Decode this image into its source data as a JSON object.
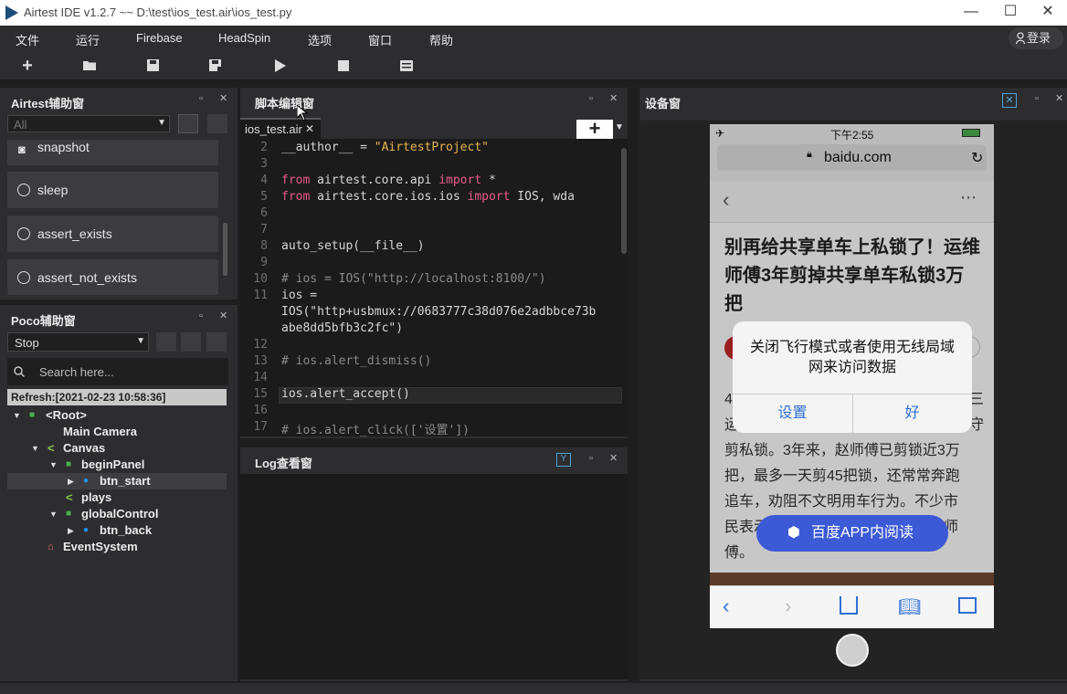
{
  "window": {
    "title": "Airtest IDE v1.2.7 ~~ D:\\test\\ios_test.air\\ios_test.py"
  },
  "menu": [
    "文件",
    "运行",
    "Firebase",
    "HeadSpin",
    "选项",
    "窗口",
    "帮助"
  ],
  "login_label": "登录",
  "airtest_panel": {
    "title": "Airtest辅助窗",
    "filter": "All",
    "commands": [
      "snapshot",
      "sleep",
      "assert_exists",
      "assert_not_exists"
    ]
  },
  "poco_panel": {
    "title": "Poco辅助窗",
    "mode": "Stop",
    "search_placeholder": "Search here...",
    "refresh": "Refresh:[2021-02-23 10:58:36]",
    "tree": [
      {
        "label": "<Root>",
        "depth": 0,
        "expanded": true
      },
      {
        "label": "Main Camera",
        "depth": 1
      },
      {
        "label": "Canvas",
        "depth": 1,
        "expanded": true
      },
      {
        "label": "beginPanel",
        "depth": 2,
        "expanded": true
      },
      {
        "label": "btn_start",
        "depth": 3,
        "selected": true,
        "collapsed": true
      },
      {
        "label": "plays",
        "depth": 3
      },
      {
        "label": "globalControl",
        "depth": 2,
        "expanded": true
      },
      {
        "label": "btn_back",
        "depth": 3,
        "collapsed": true
      },
      {
        "label": "EventSystem",
        "depth": 1
      }
    ]
  },
  "editor": {
    "title": "脚本编辑窗",
    "tab": "ios_test.air",
    "lines": [
      {
        "n": "2",
        "t": "__author__ = \"AirtestProject\""
      },
      {
        "n": "3",
        "t": ""
      },
      {
        "n": "4",
        "t": "from airtest.core.api import *"
      },
      {
        "n": "5",
        "t": "from airtest.core.ios.ios import IOS, wda"
      },
      {
        "n": "6",
        "t": ""
      },
      {
        "n": "7",
        "t": ""
      },
      {
        "n": "8",
        "t": "auto_setup(__file__)"
      },
      {
        "n": "9",
        "t": ""
      },
      {
        "n": "10",
        "t": "# ios = IOS(\"http://localhost:8100/\")"
      },
      {
        "n": "11",
        "t": "ios ="
      },
      {
        "n": "",
        "t": "IOS(\"http+usbmux://0683777c38d076e2adbbce73b"
      },
      {
        "n": "",
        "t": "abe8dd5bfb3c2fc\")"
      },
      {
        "n": "12",
        "t": ""
      },
      {
        "n": "13",
        "t": "# ios.alert_dismiss()"
      },
      {
        "n": "14",
        "t": ""
      },
      {
        "n": "15",
        "t": "ios.alert_accept()"
      },
      {
        "n": "16",
        "t": ""
      },
      {
        "n": "17",
        "t": "# ios.alert_click(['设置'])"
      }
    ]
  },
  "log_panel": {
    "title": "Log查看窗"
  },
  "device_panel": {
    "title": "设备窗",
    "status_time": "下午2:55",
    "url": "baidu.com",
    "headline": "别再给共享单车上私锁了！运维师傅3年剪掉共享单车私锁3万把",
    "body_lines": [
      "4",
      "运",
      "剪私锁。3年来，赵师傅已剪锁近3万",
      "把，最多一天剪45把锁，还常常奔跑",
      "追车，劝阻不文明用车行为。不少市",
      "民表示，很反感锁车行为，力挺赵师",
      "傅。"
    ],
    "body_right": [
      "三",
      "守"
    ],
    "alert": {
      "message": "关闭飞行模式或者使用无线局域网来访问数据",
      "btn_settings": "设置",
      "btn_ok": "好"
    },
    "app_button": "百度APP内阅读"
  }
}
